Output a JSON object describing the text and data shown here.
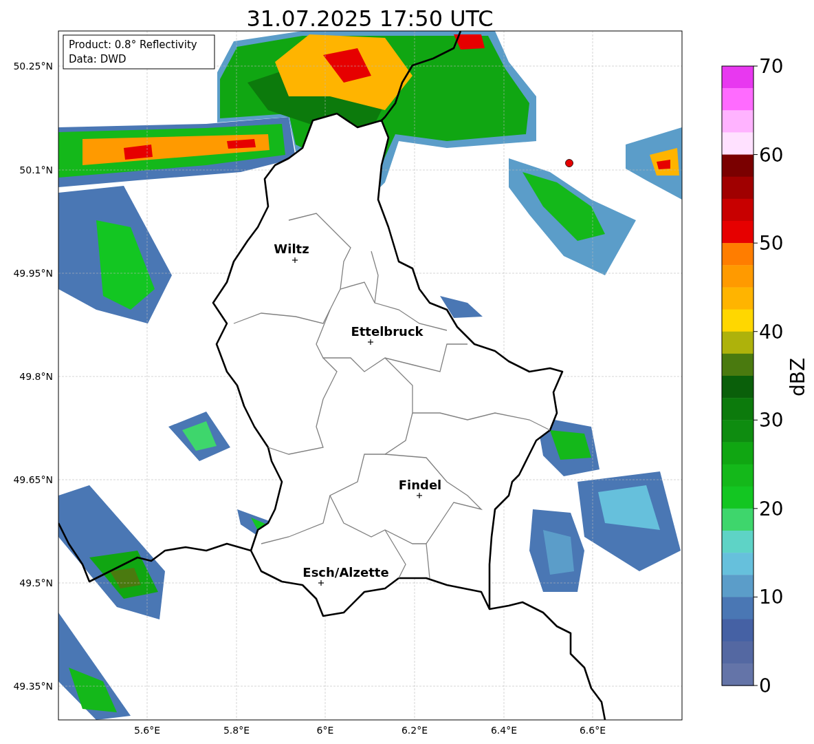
{
  "title": "31.07.2025 17:50 UTC",
  "map": {
    "info_lines": [
      "Product: 0.8° Reflectivity",
      "Data: DWD"
    ],
    "lat_labels": [
      "50.25°N",
      "50.1°N",
      "49.95°N",
      "49.8°N",
      "49.65°N",
      "49.5°N",
      "49.35°N"
    ],
    "lon_labels": [
      "5.6°E",
      "5.8°E",
      "6°E",
      "6.2°E",
      "6.4°E",
      "6.6°E"
    ],
    "cities": [
      {
        "name": "Wiltz"
      },
      {
        "name": "Ettelbruck"
      },
      {
        "name": "Findel"
      },
      {
        "name": "Esch/Alzette"
      }
    ]
  },
  "colorbar": {
    "label": "dBZ",
    "ticks": [
      "70",
      "60",
      "50",
      "40",
      "30",
      "20",
      "10",
      "0"
    ],
    "segments": [
      {
        "color": "#e838f0"
      },
      {
        "color": "#ff6bff"
      },
      {
        "color": "#ffb3ff"
      },
      {
        "color": "#ffe1ff"
      },
      {
        "color": "#7a0000"
      },
      {
        "color": "#a00000"
      },
      {
        "color": "#c80000"
      },
      {
        "color": "#e60000"
      },
      {
        "color": "#ff7d00"
      },
      {
        "color": "#ff9a00"
      },
      {
        "color": "#ffb400"
      },
      {
        "color": "#ffd700"
      },
      {
        "color": "#aeb20b"
      },
      {
        "color": "#4a7a0f"
      },
      {
        "color": "#0a5f0a"
      },
      {
        "color": "#0c7a0c"
      },
      {
        "color": "#0e8c10"
      },
      {
        "color": "#10a612"
      },
      {
        "color": "#14b81a"
      },
      {
        "color": "#13c622"
      },
      {
        "color": "#3ed66c"
      },
      {
        "color": "#5ed3c6"
      },
      {
        "color": "#66c0dc"
      },
      {
        "color": "#5b9dc9"
      },
      {
        "color": "#4a77b4"
      },
      {
        "color": "#4561a4"
      },
      {
        "color": "#5468a2"
      },
      {
        "color": "#6474a8"
      }
    ]
  }
}
